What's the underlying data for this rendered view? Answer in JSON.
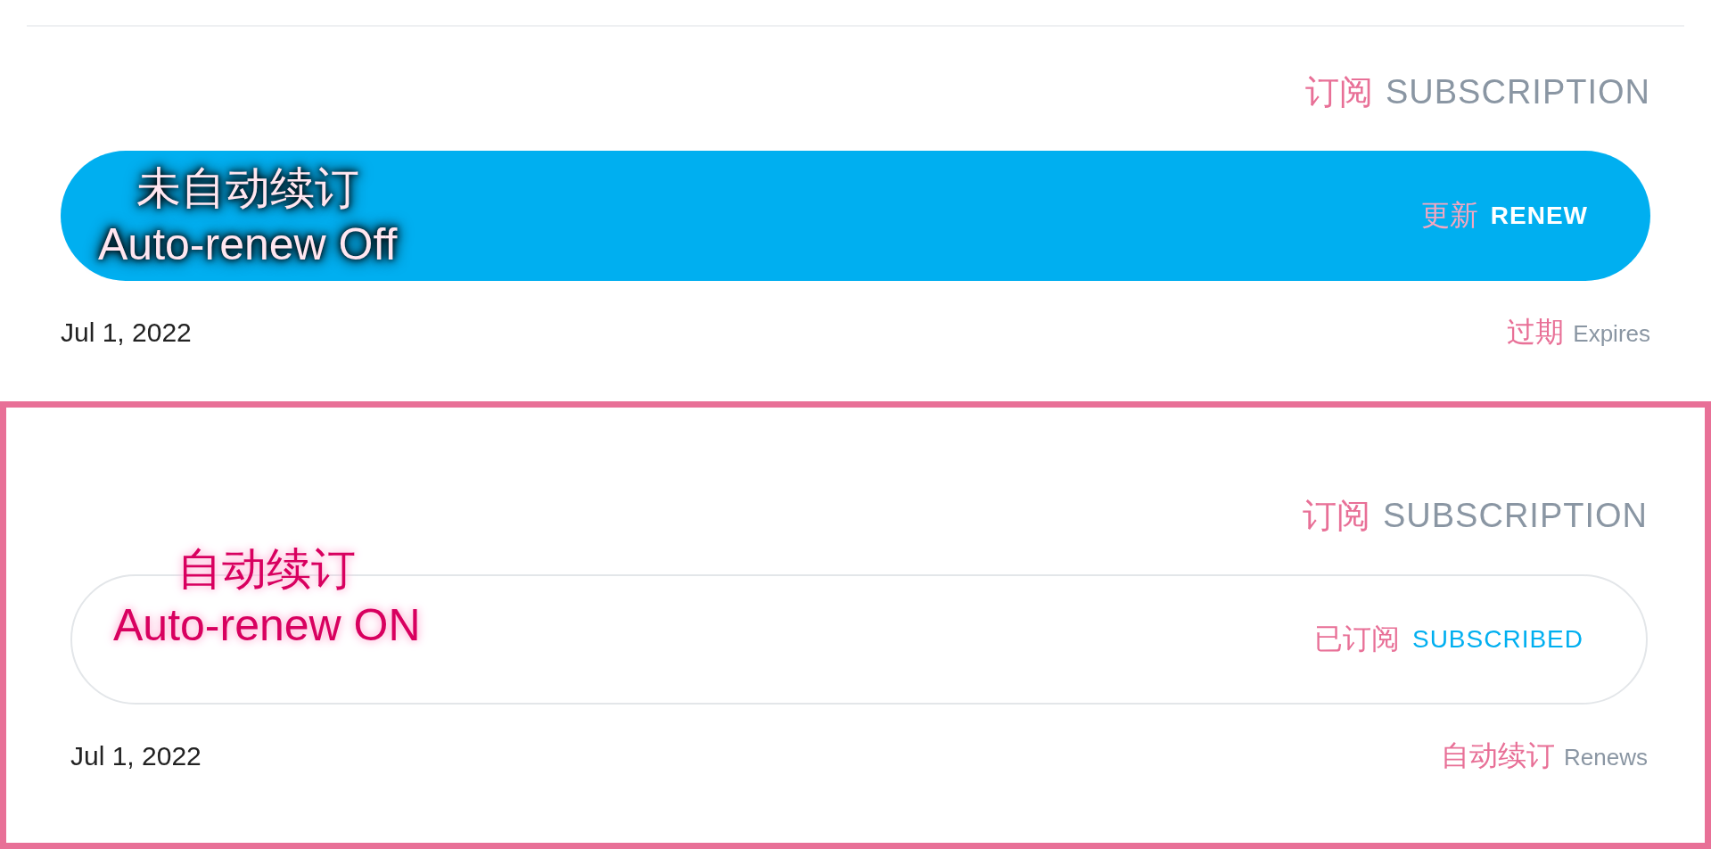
{
  "cards": [
    {
      "title": "SUBSCRIPTION",
      "title_note": "订阅",
      "highlighted": false,
      "button": {
        "kind": "renew",
        "label": "RENEW",
        "note": "更新"
      },
      "date_label": "Expires",
      "date_label_note": "过期",
      "date": "Jul 1, 2022",
      "annotation": {
        "kind": "off",
        "lines": [
          "未自动续订",
          "Auto-renew Off"
        ]
      }
    },
    {
      "title": "SUBSCRIPTION",
      "title_note": "订阅",
      "highlighted": true,
      "button": {
        "kind": "subscribed",
        "label": "SUBSCRIBED",
        "note": "已订阅"
      },
      "date_label": "Renews",
      "date_label_note": "自动续订",
      "date": "Jul 1, 2022",
      "annotation": {
        "kind": "on",
        "lines": [
          "自动续订",
          "Auto-renew ON"
        ]
      }
    }
  ]
}
